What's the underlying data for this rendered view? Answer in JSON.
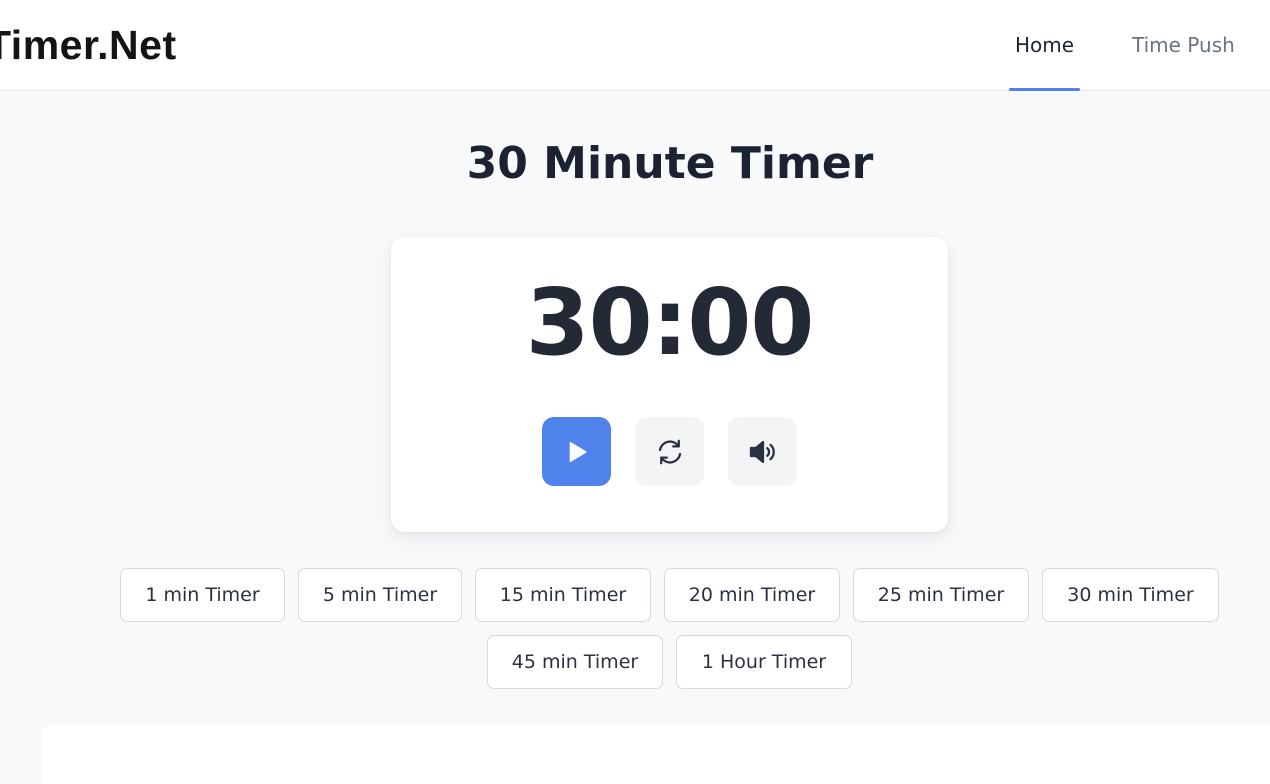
{
  "header": {
    "logo": "Timer.Net",
    "nav": [
      {
        "label": "Home",
        "active": true
      },
      {
        "label": "Time Push",
        "active": false
      }
    ],
    "accent_color": "#4f82ea"
  },
  "main": {
    "title": "30 Minute Timer",
    "timer": {
      "display": "30:00",
      "controls": [
        {
          "name": "play",
          "icon": "play-icon"
        },
        {
          "name": "reset",
          "icon": "refresh-icon"
        },
        {
          "name": "sound",
          "icon": "speaker-icon"
        }
      ]
    },
    "presets": [
      "1 min Timer",
      "5 min Timer",
      "15 min Timer",
      "20 min Timer",
      "25 min Timer",
      "30 min Timer",
      "45 min Timer",
      "1 Hour Timer"
    ]
  }
}
